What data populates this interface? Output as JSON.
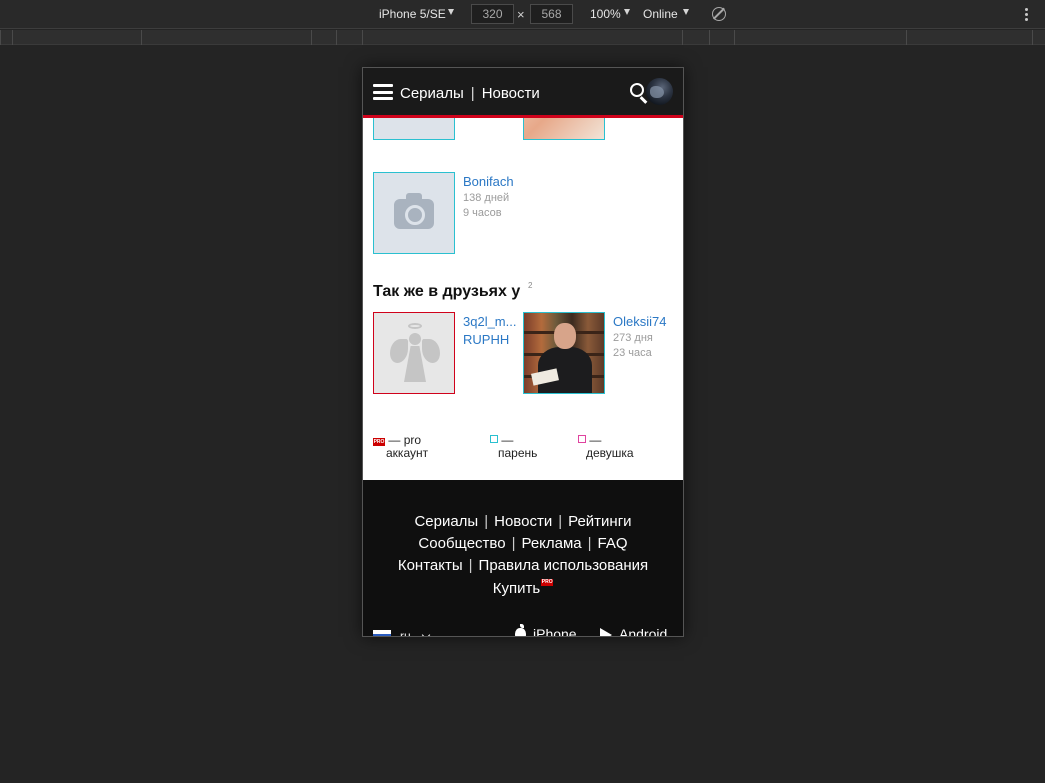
{
  "devtools": {
    "device": "iPhone 5/SE",
    "width": "320",
    "height": "568",
    "times": "×",
    "zoom": "100%",
    "network": "Online"
  },
  "header": {
    "nav": [
      "Сериалы",
      "Новости"
    ],
    "sep": "|"
  },
  "friends": [
    {
      "name": "Bonifach",
      "meta1": "138 дней",
      "meta2": "9 часов"
    }
  ],
  "also_friends": {
    "title": "Так же в друзьях у",
    "count": "2",
    "items": [
      {
        "name1": "3q2l_m...",
        "name2": "RUPHH"
      },
      {
        "name": "Oleksii74",
        "meta1": "273 дня",
        "meta2": "23 часа"
      }
    ]
  },
  "legend": {
    "pro_badge": "PRO",
    "pro_dash": "—",
    "pro_word": "pro",
    "pro_label2": "аккаунт",
    "male_dash": "—",
    "male_label": "парень",
    "female_dash": "—",
    "female_label": "девушка"
  },
  "footer": {
    "line1": [
      "Сериалы",
      "Новости",
      "Рейтинги"
    ],
    "line2": [
      "Сообщество",
      "Реклама",
      "FAQ"
    ],
    "line3": [
      "Контакты",
      "Правила использования"
    ],
    "buy": "Купить",
    "buy_badge": "PRO",
    "sep": "|",
    "lang": "ru",
    "iphone": "iPhone",
    "android": "Android"
  }
}
